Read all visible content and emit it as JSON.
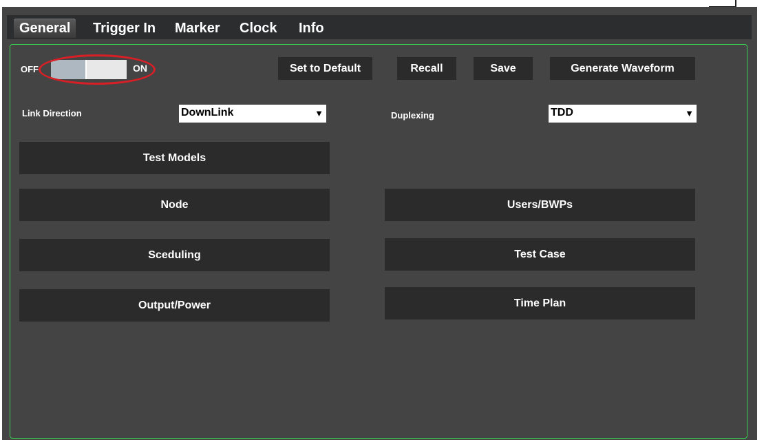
{
  "tabs": [
    {
      "label": "General",
      "active": true
    },
    {
      "label": "Trigger In"
    },
    {
      "label": "Marker"
    },
    {
      "label": "Clock"
    },
    {
      "label": "Info"
    }
  ],
  "toggle": {
    "off_label": "OFF",
    "on_label": "ON",
    "level": 0.45
  },
  "actions": {
    "set_default": "Set to Default",
    "recall": "Recall",
    "save": "Save",
    "generate": "Generate Waveform"
  },
  "link_direction": {
    "label": "Link Direction",
    "value": "DownLink"
  },
  "duplexing": {
    "label": "Duplexing",
    "value": "TDD"
  },
  "dropdown_arrow": "▼",
  "sections": {
    "test_models": "Test Models",
    "node": "Node",
    "users_bwps": "Users/BWPs",
    "sceduling": "Sceduling",
    "test_case": "Test Case",
    "output_power": "Output/Power",
    "time_plan": "Time Plan"
  },
  "colors": {
    "panel_border": "#39d353",
    "highlight_ring": "#d81f26",
    "background": "#444444",
    "button": "#2b2b2b"
  }
}
